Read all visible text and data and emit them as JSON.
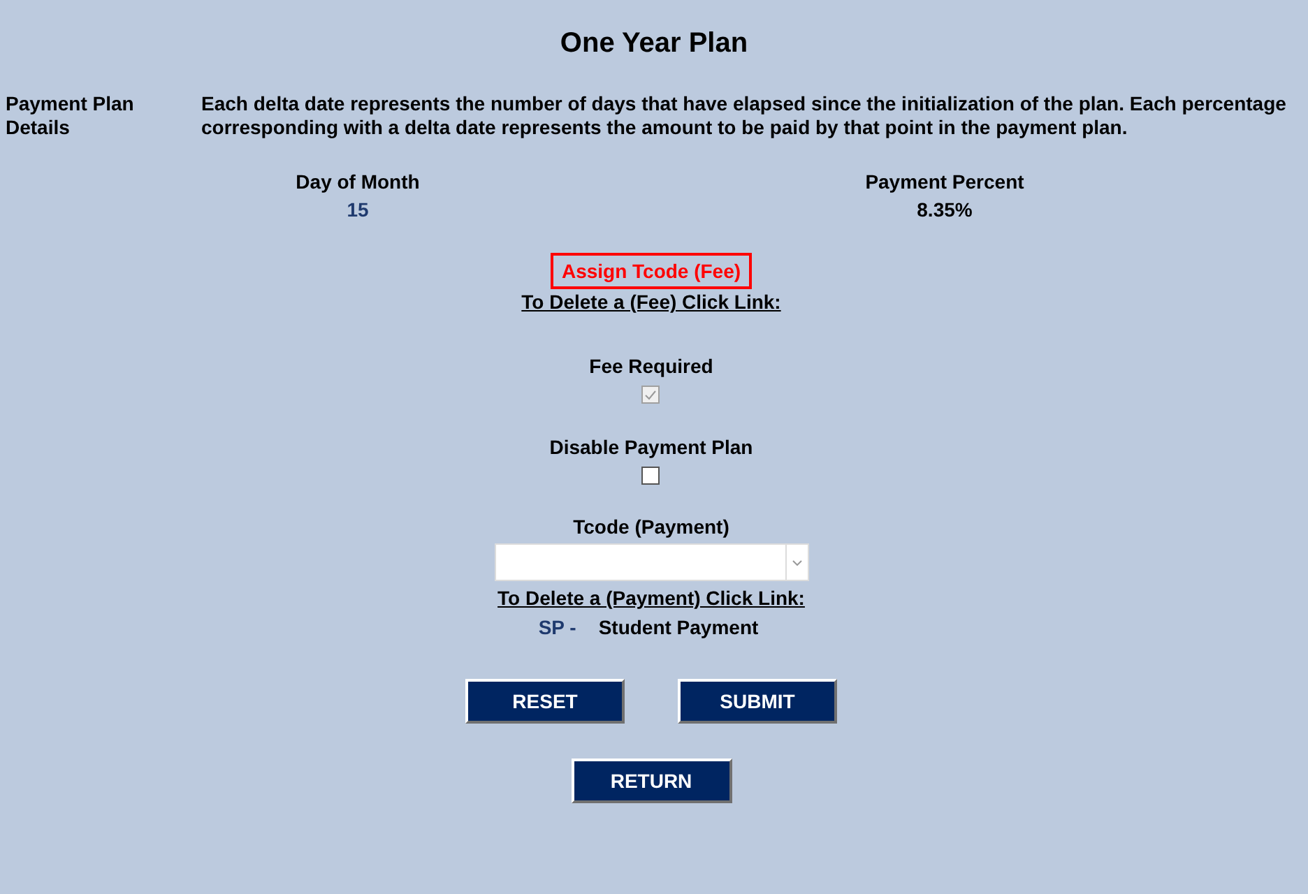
{
  "title": "One Year Plan",
  "details": {
    "label": "Payment Plan Details",
    "text": "Each delta date represents the number of days that have elapsed since the initialization of the plan. Each percentage corresponding with a delta date represents the amount to be paid by that point in the payment plan."
  },
  "schedule": {
    "columns": [
      "Day of Month",
      "Payment Percent"
    ],
    "rows": [
      [
        "15",
        "8.35%"
      ]
    ]
  },
  "fee_link": "Assign Tcode (Fee)",
  "fee_delete_heading": "To Delete a (Fee) Click Link:",
  "checkboxes": [
    {
      "label": "Fee Required",
      "checked": true,
      "disabled": true
    },
    {
      "label": "Disable Payment Plan",
      "checked": false,
      "disabled": false
    }
  ],
  "payment_select": {
    "label": "Tcode (Payment)"
  },
  "payment_delete_heading": "To Delete a (Payment) Click Link:",
  "payment_tcodes": [
    {
      "code": "SP -",
      "description": "Student Payment"
    }
  ],
  "buttons": [
    "RESET",
    "SUBMIT"
  ],
  "return_button": "RETURN"
}
